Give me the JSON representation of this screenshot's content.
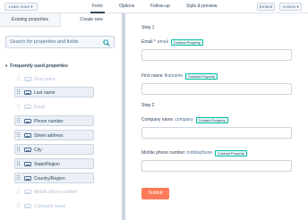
{
  "header": {
    "learn_more": "Learn more ▾",
    "tabs": [
      "Form",
      "Options",
      "Follow-up",
      "Style & preview"
    ],
    "embed": "Embed",
    "actions": "Actions ▾"
  },
  "sidebar": {
    "tabs": [
      "Existing properties",
      "Create new"
    ],
    "search_placeholder": "Search for properties and fields",
    "section_title": "Frequently used properties",
    "properties": [
      {
        "label": "First name",
        "enabled": false
      },
      {
        "label": "Last name",
        "enabled": true
      },
      {
        "label": "Email",
        "enabled": false
      },
      {
        "label": "Phone number",
        "enabled": true
      },
      {
        "label": "Street address",
        "enabled": true
      },
      {
        "label": "City",
        "enabled": true
      },
      {
        "label": "State/Region",
        "enabled": true
      },
      {
        "label": "Country/Region",
        "enabled": true
      },
      {
        "label": "Mobile phone number",
        "enabled": false
      },
      {
        "label": "Company name",
        "enabled": false
      }
    ]
  },
  "form": {
    "step1": "Step 1",
    "step2": "Step 2",
    "fields": [
      {
        "label": "Email *",
        "internal": "email",
        "badge": "Contact Property"
      },
      {
        "label": "First name",
        "internal": "firstname",
        "badge": "Contact Property"
      },
      {
        "label": "Company name",
        "internal": "company",
        "badge": "Contact Property"
      },
      {
        "label": "Mobile phone number",
        "internal": "mobilephone",
        "badge": "Contact Property"
      }
    ],
    "submit": "Submit"
  },
  "colors": {
    "accent": "#ff7a59",
    "badge_border": "#00bda5",
    "text": "#33475b"
  }
}
